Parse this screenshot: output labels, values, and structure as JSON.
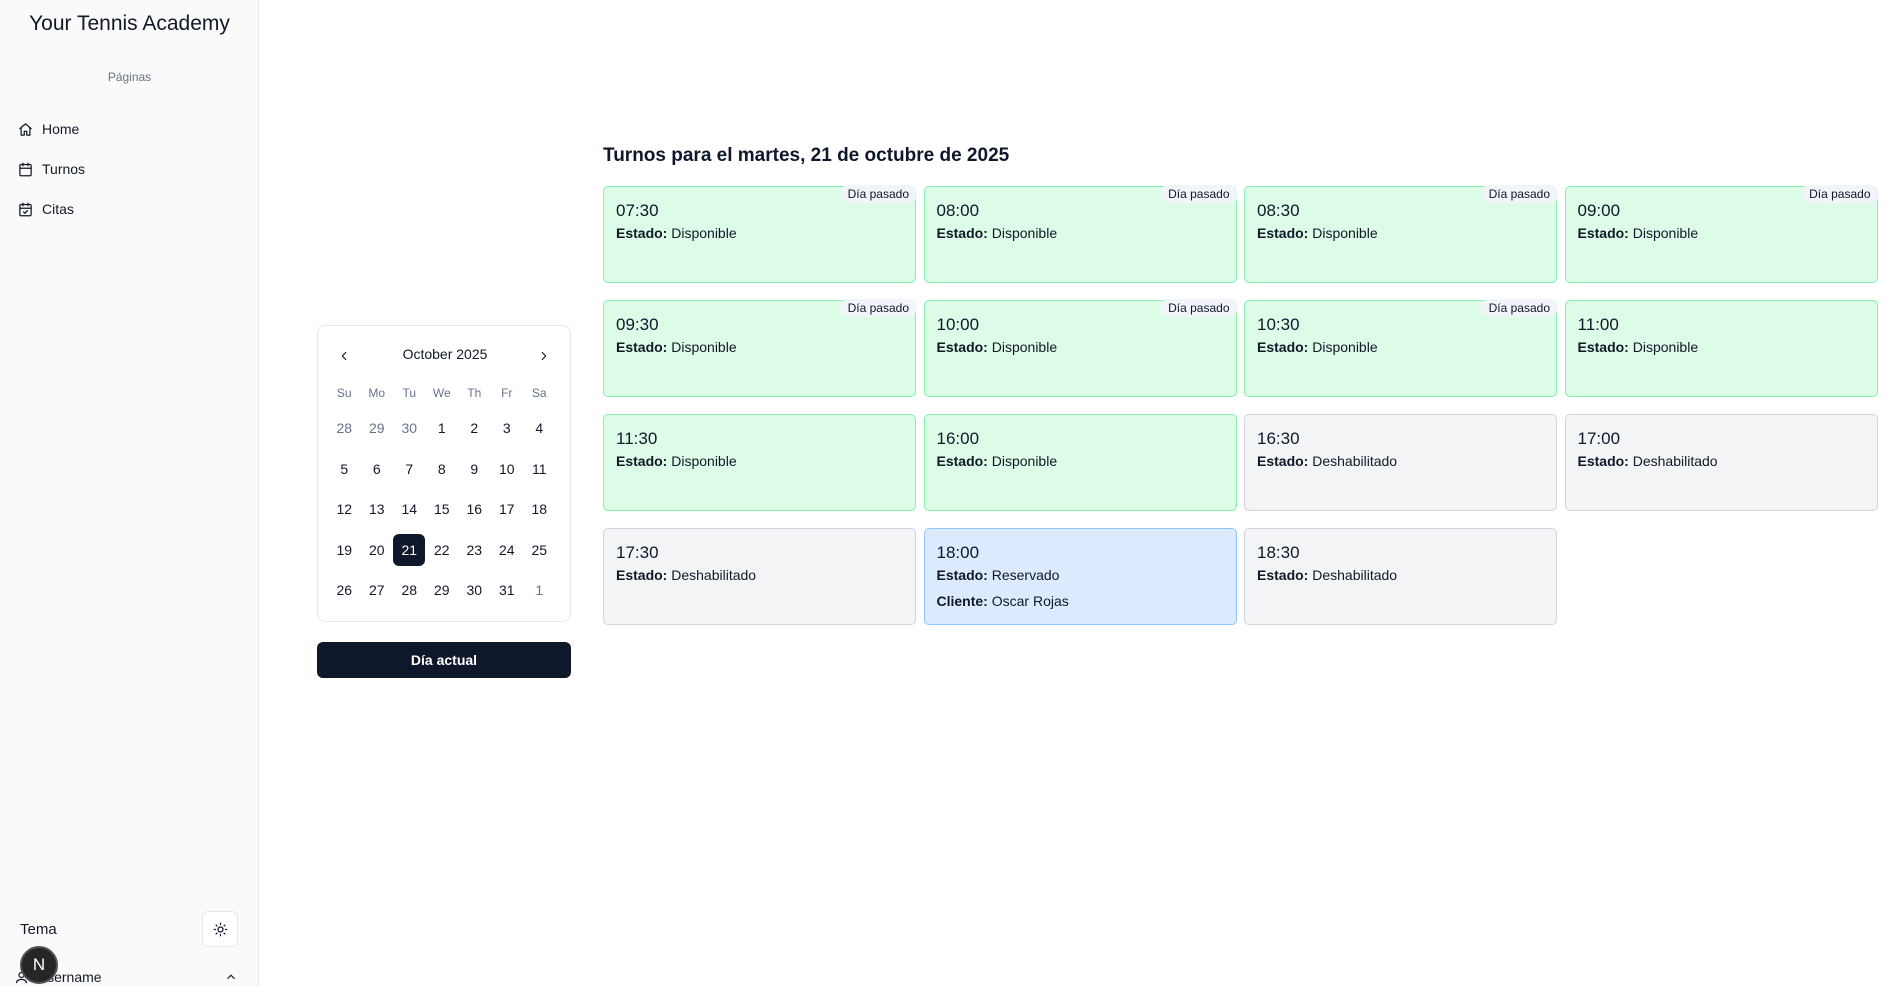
{
  "sidebar": {
    "brand": "Your Tennis Academy",
    "section_label": "Páginas",
    "items": [
      {
        "label": "Home",
        "icon": "house-icon"
      },
      {
        "label": "Turnos",
        "icon": "calendar-icon"
      },
      {
        "label": "Citas",
        "icon": "calendar-check-icon"
      }
    ],
    "theme_label": "Tema",
    "theme_icon": "sun-icon",
    "avatar_initial": "N",
    "username": "Username"
  },
  "calendar": {
    "month_label": "October 2025",
    "weekdays": [
      "Su",
      "Mo",
      "Tu",
      "We",
      "Th",
      "Fr",
      "Sa"
    ],
    "weeks": [
      [
        {
          "d": "28",
          "o": true
        },
        {
          "d": "29",
          "o": true
        },
        {
          "d": "30",
          "o": true
        },
        {
          "d": "1"
        },
        {
          "d": "2"
        },
        {
          "d": "3"
        },
        {
          "d": "4"
        }
      ],
      [
        {
          "d": "5"
        },
        {
          "d": "6"
        },
        {
          "d": "7"
        },
        {
          "d": "8"
        },
        {
          "d": "9"
        },
        {
          "d": "10"
        },
        {
          "d": "11"
        }
      ],
      [
        {
          "d": "12"
        },
        {
          "d": "13"
        },
        {
          "d": "14"
        },
        {
          "d": "15"
        },
        {
          "d": "16"
        },
        {
          "d": "17"
        },
        {
          "d": "18"
        }
      ],
      [
        {
          "d": "19"
        },
        {
          "d": "20"
        },
        {
          "d": "21",
          "s": true
        },
        {
          "d": "22"
        },
        {
          "d": "23"
        },
        {
          "d": "24"
        },
        {
          "d": "25"
        }
      ],
      [
        {
          "d": "26"
        },
        {
          "d": "27"
        },
        {
          "d": "28"
        },
        {
          "d": "29"
        },
        {
          "d": "30"
        },
        {
          "d": "31"
        },
        {
          "d": "1",
          "o": true
        }
      ]
    ],
    "today_button": "Día actual"
  },
  "slots": {
    "title": "Turnos para el martes, 21 de octubre de 2025",
    "estado_label": "Estado:",
    "cliente_label": "Cliente:",
    "items": [
      {
        "time": "07:30",
        "estado": "Disponible",
        "badge": "Día pasado",
        "kind": "disponible"
      },
      {
        "time": "08:00",
        "estado": "Disponible",
        "badge": "Día pasado",
        "kind": "disponible"
      },
      {
        "time": "08:30",
        "estado": "Disponible",
        "badge": "Día pasado",
        "kind": "disponible"
      },
      {
        "time": "09:00",
        "estado": "Disponible",
        "badge": "Día pasado",
        "kind": "disponible"
      },
      {
        "time": "09:30",
        "estado": "Disponible",
        "badge": "Día pasado",
        "kind": "disponible"
      },
      {
        "time": "10:00",
        "estado": "Disponible",
        "badge": "Día pasado",
        "kind": "disponible"
      },
      {
        "time": "10:30",
        "estado": "Disponible",
        "badge": "Día pasado",
        "kind": "disponible"
      },
      {
        "time": "11:00",
        "estado": "Disponible",
        "kind": "disponible"
      },
      {
        "time": "11:30",
        "estado": "Disponible",
        "kind": "disponible"
      },
      {
        "time": "16:00",
        "estado": "Disponible",
        "kind": "disponible"
      },
      {
        "time": "16:30",
        "estado": "Deshabilitado",
        "kind": "deshabilitado"
      },
      {
        "time": "17:00",
        "estado": "Deshabilitado",
        "kind": "deshabilitado"
      },
      {
        "time": "17:30",
        "estado": "Deshabilitado",
        "kind": "deshabilitado"
      },
      {
        "time": "18:00",
        "estado": "Reservado",
        "cliente": "Oscar Rojas",
        "kind": "reservado"
      },
      {
        "time": "18:30",
        "estado": "Deshabilitado",
        "kind": "deshabilitado"
      }
    ]
  },
  "colors": {
    "disponible_bg": "#dcfce7",
    "deshabilitado_bg": "#f3f4f6",
    "reservado_bg": "#dbeafe",
    "primary": "#0f172a"
  }
}
